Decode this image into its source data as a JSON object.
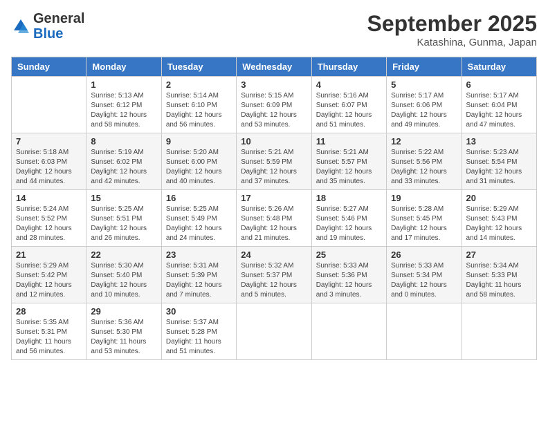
{
  "header": {
    "logo_general": "General",
    "logo_blue": "Blue",
    "month_title": "September 2025",
    "location": "Katashina, Gunma, Japan"
  },
  "weekdays": [
    "Sunday",
    "Monday",
    "Tuesday",
    "Wednesday",
    "Thursday",
    "Friday",
    "Saturday"
  ],
  "weeks": [
    [
      {
        "day": "",
        "sunrise": "",
        "sunset": "",
        "daylight": ""
      },
      {
        "day": "1",
        "sunrise": "Sunrise: 5:13 AM",
        "sunset": "Sunset: 6:12 PM",
        "daylight": "Daylight: 12 hours and 58 minutes."
      },
      {
        "day": "2",
        "sunrise": "Sunrise: 5:14 AM",
        "sunset": "Sunset: 6:10 PM",
        "daylight": "Daylight: 12 hours and 56 minutes."
      },
      {
        "day": "3",
        "sunrise": "Sunrise: 5:15 AM",
        "sunset": "Sunset: 6:09 PM",
        "daylight": "Daylight: 12 hours and 53 minutes."
      },
      {
        "day": "4",
        "sunrise": "Sunrise: 5:16 AM",
        "sunset": "Sunset: 6:07 PM",
        "daylight": "Daylight: 12 hours and 51 minutes."
      },
      {
        "day": "5",
        "sunrise": "Sunrise: 5:17 AM",
        "sunset": "Sunset: 6:06 PM",
        "daylight": "Daylight: 12 hours and 49 minutes."
      },
      {
        "day": "6",
        "sunrise": "Sunrise: 5:17 AM",
        "sunset": "Sunset: 6:04 PM",
        "daylight": "Daylight: 12 hours and 47 minutes."
      }
    ],
    [
      {
        "day": "7",
        "sunrise": "Sunrise: 5:18 AM",
        "sunset": "Sunset: 6:03 PM",
        "daylight": "Daylight: 12 hours and 44 minutes."
      },
      {
        "day": "8",
        "sunrise": "Sunrise: 5:19 AM",
        "sunset": "Sunset: 6:02 PM",
        "daylight": "Daylight: 12 hours and 42 minutes."
      },
      {
        "day": "9",
        "sunrise": "Sunrise: 5:20 AM",
        "sunset": "Sunset: 6:00 PM",
        "daylight": "Daylight: 12 hours and 40 minutes."
      },
      {
        "day": "10",
        "sunrise": "Sunrise: 5:21 AM",
        "sunset": "Sunset: 5:59 PM",
        "daylight": "Daylight: 12 hours and 37 minutes."
      },
      {
        "day": "11",
        "sunrise": "Sunrise: 5:21 AM",
        "sunset": "Sunset: 5:57 PM",
        "daylight": "Daylight: 12 hours and 35 minutes."
      },
      {
        "day": "12",
        "sunrise": "Sunrise: 5:22 AM",
        "sunset": "Sunset: 5:56 PM",
        "daylight": "Daylight: 12 hours and 33 minutes."
      },
      {
        "day": "13",
        "sunrise": "Sunrise: 5:23 AM",
        "sunset": "Sunset: 5:54 PM",
        "daylight": "Daylight: 12 hours and 31 minutes."
      }
    ],
    [
      {
        "day": "14",
        "sunrise": "Sunrise: 5:24 AM",
        "sunset": "Sunset: 5:52 PM",
        "daylight": "Daylight: 12 hours and 28 minutes."
      },
      {
        "day": "15",
        "sunrise": "Sunrise: 5:25 AM",
        "sunset": "Sunset: 5:51 PM",
        "daylight": "Daylight: 12 hours and 26 minutes."
      },
      {
        "day": "16",
        "sunrise": "Sunrise: 5:25 AM",
        "sunset": "Sunset: 5:49 PM",
        "daylight": "Daylight: 12 hours and 24 minutes."
      },
      {
        "day": "17",
        "sunrise": "Sunrise: 5:26 AM",
        "sunset": "Sunset: 5:48 PM",
        "daylight": "Daylight: 12 hours and 21 minutes."
      },
      {
        "day": "18",
        "sunrise": "Sunrise: 5:27 AM",
        "sunset": "Sunset: 5:46 PM",
        "daylight": "Daylight: 12 hours and 19 minutes."
      },
      {
        "day": "19",
        "sunrise": "Sunrise: 5:28 AM",
        "sunset": "Sunset: 5:45 PM",
        "daylight": "Daylight: 12 hours and 17 minutes."
      },
      {
        "day": "20",
        "sunrise": "Sunrise: 5:29 AM",
        "sunset": "Sunset: 5:43 PM",
        "daylight": "Daylight: 12 hours and 14 minutes."
      }
    ],
    [
      {
        "day": "21",
        "sunrise": "Sunrise: 5:29 AM",
        "sunset": "Sunset: 5:42 PM",
        "daylight": "Daylight: 12 hours and 12 minutes."
      },
      {
        "day": "22",
        "sunrise": "Sunrise: 5:30 AM",
        "sunset": "Sunset: 5:40 PM",
        "daylight": "Daylight: 12 hours and 10 minutes."
      },
      {
        "day": "23",
        "sunrise": "Sunrise: 5:31 AM",
        "sunset": "Sunset: 5:39 PM",
        "daylight": "Daylight: 12 hours and 7 minutes."
      },
      {
        "day": "24",
        "sunrise": "Sunrise: 5:32 AM",
        "sunset": "Sunset: 5:37 PM",
        "daylight": "Daylight: 12 hours and 5 minutes."
      },
      {
        "day": "25",
        "sunrise": "Sunrise: 5:33 AM",
        "sunset": "Sunset: 5:36 PM",
        "daylight": "Daylight: 12 hours and 3 minutes."
      },
      {
        "day": "26",
        "sunrise": "Sunrise: 5:33 AM",
        "sunset": "Sunset: 5:34 PM",
        "daylight": "Daylight: 12 hours and 0 minutes."
      },
      {
        "day": "27",
        "sunrise": "Sunrise: 5:34 AM",
        "sunset": "Sunset: 5:33 PM",
        "daylight": "Daylight: 11 hours and 58 minutes."
      }
    ],
    [
      {
        "day": "28",
        "sunrise": "Sunrise: 5:35 AM",
        "sunset": "Sunset: 5:31 PM",
        "daylight": "Daylight: 11 hours and 56 minutes."
      },
      {
        "day": "29",
        "sunrise": "Sunrise: 5:36 AM",
        "sunset": "Sunset: 5:30 PM",
        "daylight": "Daylight: 11 hours and 53 minutes."
      },
      {
        "day": "30",
        "sunrise": "Sunrise: 5:37 AM",
        "sunset": "Sunset: 5:28 PM",
        "daylight": "Daylight: 11 hours and 51 minutes."
      },
      {
        "day": "",
        "sunrise": "",
        "sunset": "",
        "daylight": ""
      },
      {
        "day": "",
        "sunrise": "",
        "sunset": "",
        "daylight": ""
      },
      {
        "day": "",
        "sunrise": "",
        "sunset": "",
        "daylight": ""
      },
      {
        "day": "",
        "sunrise": "",
        "sunset": "",
        "daylight": ""
      }
    ]
  ]
}
